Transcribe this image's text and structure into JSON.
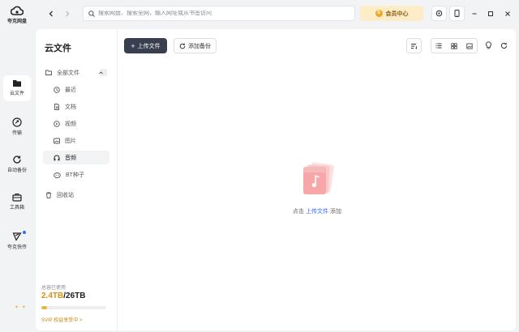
{
  "app": {
    "name": "夸克网盘"
  },
  "rail": {
    "items": [
      {
        "label": "云文件",
        "icon": "folder-icon",
        "active": true
      },
      {
        "label": "传输",
        "icon": "transfer-icon"
      },
      {
        "label": "自动备份",
        "icon": "sync-icon"
      },
      {
        "label": "工具箱",
        "icon": "toolbox-icon"
      },
      {
        "label": "夸克快传",
        "icon": "send-icon"
      }
    ]
  },
  "topbar": {
    "search_placeholder": "搜索网盘、搜索全网，输入网址或从书签访问",
    "vip_label": "会员中心"
  },
  "sidebar": {
    "title": "云文件",
    "root": "全部文件",
    "items": [
      {
        "label": "最近",
        "icon": "clock-icon"
      },
      {
        "label": "文档",
        "icon": "document-icon"
      },
      {
        "label": "视频",
        "icon": "video-icon"
      },
      {
        "label": "图片",
        "icon": "image-icon"
      },
      {
        "label": "音频",
        "icon": "headphones-icon",
        "active": true
      },
      {
        "label": "BT种子",
        "icon": "bt-icon"
      }
    ],
    "trash": "回收站"
  },
  "storage": {
    "label": "总容已使用",
    "used": "2.4TB",
    "separator": "/",
    "total": "26TB",
    "used_fraction": 0.09,
    "promo": "SVIP 权益享受中 >"
  },
  "toolbar": {
    "upload_label": "上传文件",
    "backup_label": "添加备份"
  },
  "empty_state": {
    "prefix": "点击",
    "link": "上传文件",
    "suffix": "添加"
  },
  "colors": {
    "accent": "#2f6bff",
    "primary_button": "#3a3f4f",
    "vip_bg": "#fcecc8",
    "storage_used": "#d99019",
    "music_illustration": "#f07f7f"
  }
}
